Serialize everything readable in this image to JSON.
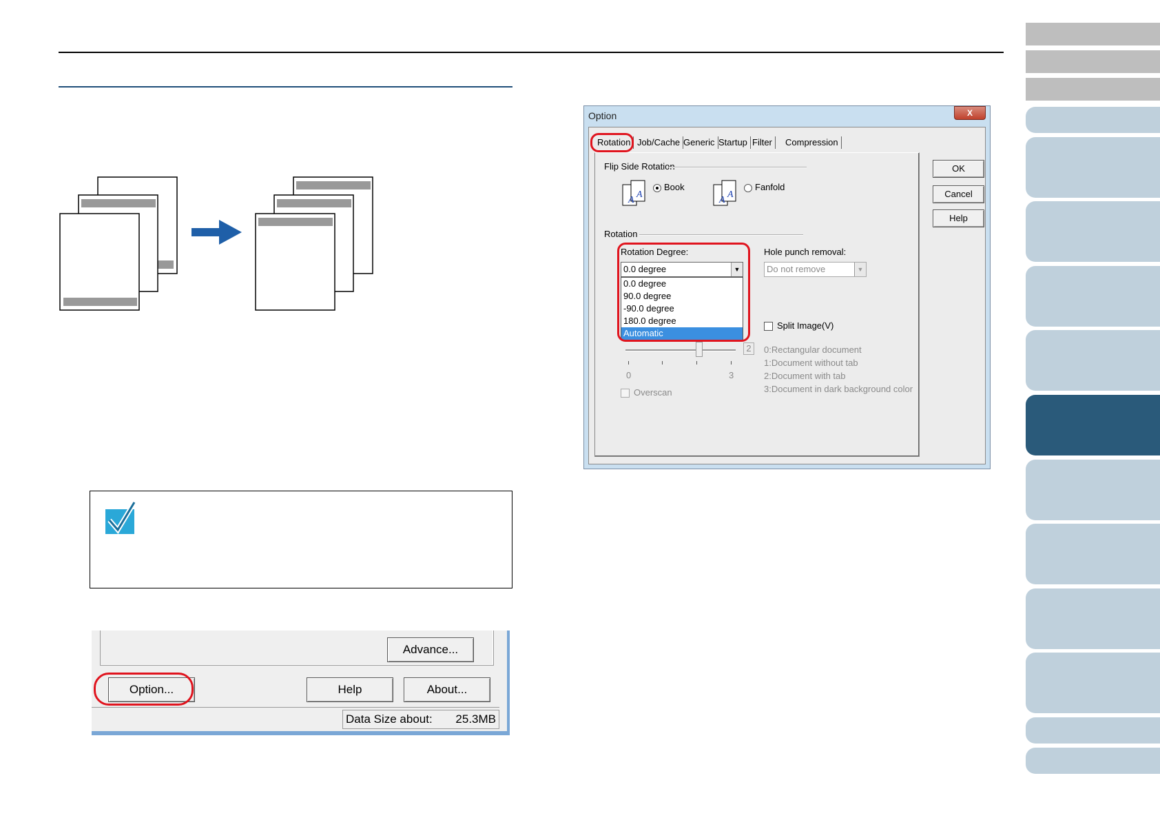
{
  "nav": {
    "tab_count": 14,
    "active_index": 6
  },
  "dialog": {
    "title": "Option",
    "close_label": "X",
    "tabs": [
      "Rotation",
      "Job/Cache",
      "Generic",
      "Startup",
      "Filter",
      "Compression"
    ],
    "active_tab": "Rotation",
    "buttons": {
      "ok": "OK",
      "cancel": "Cancel",
      "help": "Help"
    },
    "flip_side": {
      "group_label": "Flip Side Rotation",
      "book_label": "Book",
      "fanfold_label": "Fanfold",
      "selected": "Book"
    },
    "rotation": {
      "group_label": "Rotation",
      "degree_label": "Rotation Degree:",
      "degree_value": "0.0 degree",
      "options": [
        "0.0 degree",
        "90.0 degree",
        "-90.0 degree",
        "180.0 degree",
        "Automatic"
      ],
      "highlighted_option": "Automatic",
      "hole_punch_label": "Hole punch removal:",
      "hole_punch_value": "Do not remove",
      "split_image_label": "Split Image(V)",
      "slider_min": "0",
      "slider_max": "3",
      "slider_value": "2",
      "doc_types": [
        "0:Rectangular document",
        "1:Document without tab",
        "2:Document with tab",
        "3:Document in dark background color"
      ],
      "overscan_label": "Overscan"
    }
  },
  "bottom_window": {
    "advance_label": "Advance...",
    "option_label": "Option...",
    "help_label": "Help",
    "about_label": "About...",
    "data_size_label": "Data Size about:",
    "data_size_value": "25.3MB"
  },
  "colors": {
    "accent_red": "#e0141e",
    "nav_active": "#2a5a7a",
    "nav_light": "#bfd0dc",
    "arrow_blue": "#1f5fa8",
    "section_rule": "#1f4e79"
  }
}
